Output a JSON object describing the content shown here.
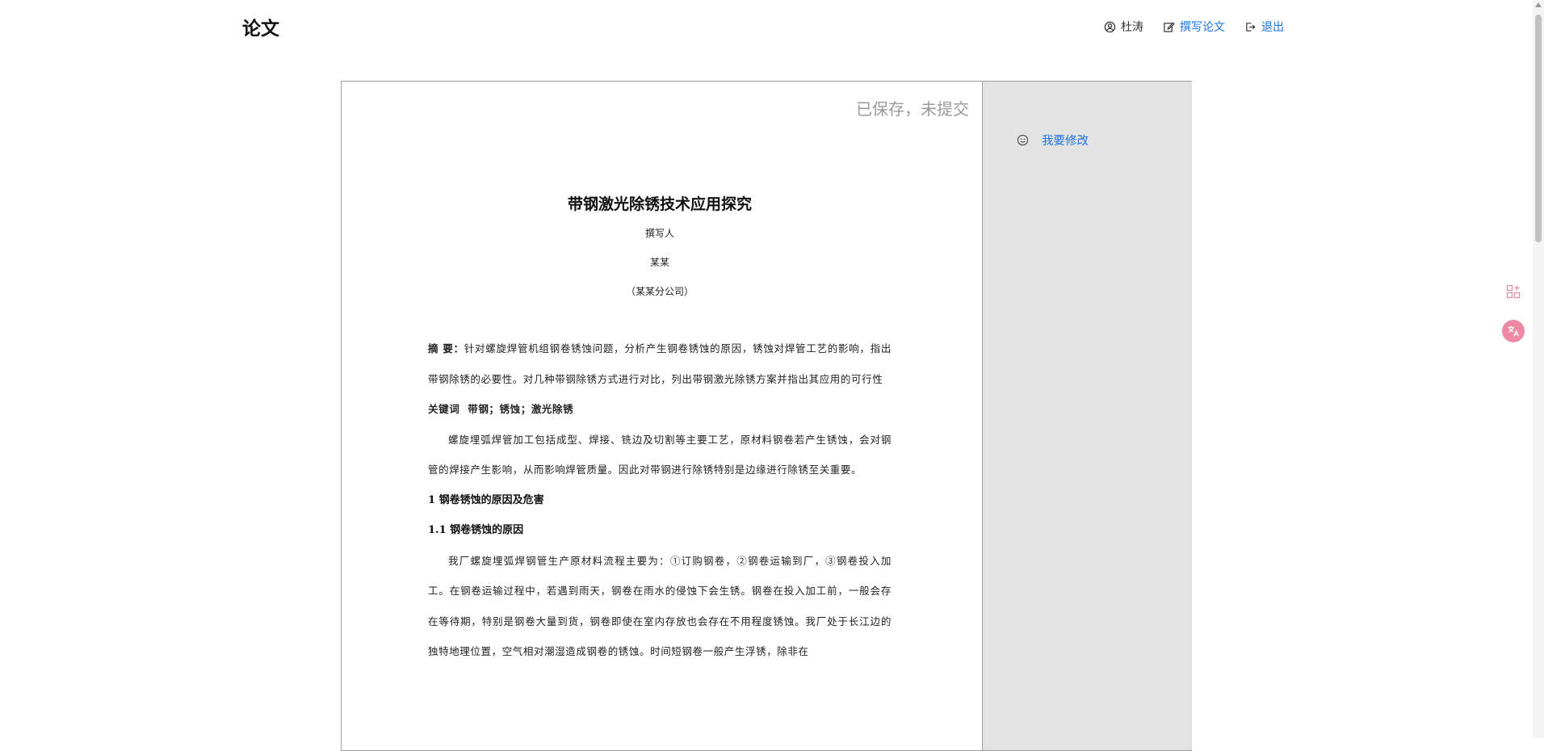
{
  "app": {
    "brand": "论文"
  },
  "nav": {
    "user_name": "杜涛",
    "write_label": "撰写论文",
    "logout_label": "退出"
  },
  "editor": {
    "save_status": "已保存，未提交",
    "edit_label": "我要修改"
  },
  "document": {
    "title": "带钢激光除锈技术应用探究",
    "author_label": "撰写人",
    "author": "某某",
    "affiliation": "（某某分公司）",
    "abstract_label": "摘 要：",
    "abstract_text": "针对螺旋焊管机组钢卷锈蚀问题，分析产生钢卷锈蚀的原因，锈蚀对焊管工艺的影响，指出带钢除锈的必要性。对几种带钢除锈方式进行对比，列出带钢激光除锈方案并指出其应用的可行性",
    "keywords_label": "关键词",
    "keywords_text": "带钢；锈蚀；激光除锈",
    "intro_paragraph": "螺旋埋弧焊管加工包括成型、焊接、铣边及切割等主要工艺，原材料钢卷若产生锈蚀，会对钢管的焊接产生影响，从而影响焊管质量。因此对带钢进行除锈特别是边缘进行除锈至关重要。",
    "section1_heading": "1 钢卷锈蚀的原因及危害",
    "section1_1_heading": "1.1 钢卷锈蚀的原因",
    "section1_1_paragraph": "我厂螺旋埋弧焊钢管生产原材料流程主要为：①订购钢卷，②钢卷运输到厂，③钢卷投入加工。在钢卷运输过程中，若遇到雨天，钢卷在雨水的侵蚀下会生锈。钢卷在投入加工前，一般会存在等待期，特别是钢卷大量到货，钢卷即使在室内存放也会存在不用程度锈蚀。我厂处于长江边的独特地理位置，空气相对潮湿造成钢卷的锈蚀。时间短钢卷一般产生浮锈，除非在"
  }
}
